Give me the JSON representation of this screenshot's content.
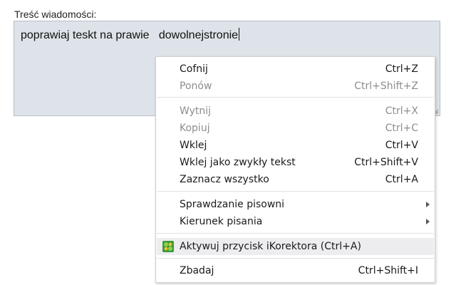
{
  "form": {
    "label": "Treść wiadomości:",
    "message_value": "poprawiaj teskt na prawie   dowolnejstronie"
  },
  "context_menu": {
    "undo": {
      "label": "Cofnij",
      "shortcut": "Ctrl+Z",
      "enabled": true
    },
    "redo": {
      "label": "Ponów",
      "shortcut": "Ctrl+Shift+Z",
      "enabled": false
    },
    "cut": {
      "label": "Wytnij",
      "shortcut": "Ctrl+X",
      "enabled": false
    },
    "copy": {
      "label": "Kopiuj",
      "shortcut": "Ctrl+C",
      "enabled": false
    },
    "paste": {
      "label": "Wklej",
      "shortcut": "Ctrl+V",
      "enabled": true
    },
    "paste_plain": {
      "label": "Wklej jako zwykły tekst",
      "shortcut": "Ctrl+Shift+V",
      "enabled": true
    },
    "select_all": {
      "label": "Zaznacz wszystko",
      "shortcut": "Ctrl+A",
      "enabled": true
    },
    "spellcheck": {
      "label": "Sprawdzanie pisowni",
      "submenu": true
    },
    "writing_direction": {
      "label": "Kierunek pisania",
      "submenu": true
    },
    "ikorektor": {
      "label": "Aktywuj przycisk iKorektora (Ctrl+A)",
      "icon": "ikorektor-extension-icon",
      "hovered": true
    },
    "inspect": {
      "label": "Zbadaj",
      "shortcut": "Ctrl+Shift+I",
      "enabled": true
    }
  },
  "colors": {
    "textarea_bg": "#dde3e8",
    "menu_hover": "#ededf0",
    "disabled_text": "#8d8d8d"
  }
}
